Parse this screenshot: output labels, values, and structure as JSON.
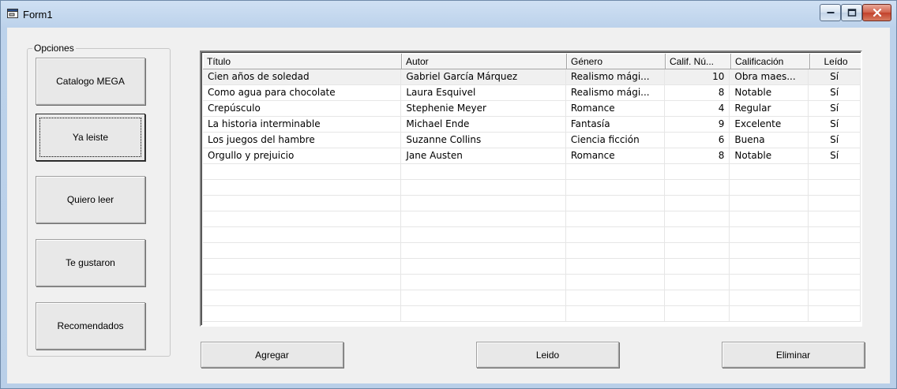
{
  "window": {
    "title": "Form1"
  },
  "options_group": {
    "label": "Opciones",
    "buttons": [
      {
        "label": "Catalogo MEGA"
      },
      {
        "label": "Ya leiste"
      },
      {
        "label": "Quiero leer"
      },
      {
        "label": "Te gustaron"
      },
      {
        "label": "Recomendados"
      }
    ]
  },
  "listview": {
    "columns": [
      "Título",
      "Autor",
      "Género",
      "Calif. Nú...",
      "Calificación",
      "Leído"
    ],
    "rows": [
      [
        "Cien años de soledad",
        "Gabriel García Márquez",
        "Realismo mági...",
        "10",
        "Obra maes...",
        "Sí"
      ],
      [
        "Como agua para chocolate",
        "Laura Esquivel",
        "Realismo mági...",
        "8",
        "Notable",
        "Sí"
      ],
      [
        "Crepúsculo",
        "Stephenie Meyer",
        "Romance",
        "4",
        "Regular",
        "Sí"
      ],
      [
        "La historia interminable",
        "Michael Ende",
        "Fantasía",
        "9",
        "Excelente",
        "Sí"
      ],
      [
        "Los juegos del hambre",
        "Suzanne Collins",
        "Ciencia ficción",
        "6",
        "Buena",
        "Sí"
      ],
      [
        "Orgullo y prejuicio",
        "Jane Austen",
        "Romance",
        "8",
        "Notable",
        "Sí"
      ]
    ],
    "empty_rows": 10
  },
  "actions": {
    "add_label": "Agregar",
    "read_label": "Leido",
    "delete_label": "Eliminar"
  }
}
